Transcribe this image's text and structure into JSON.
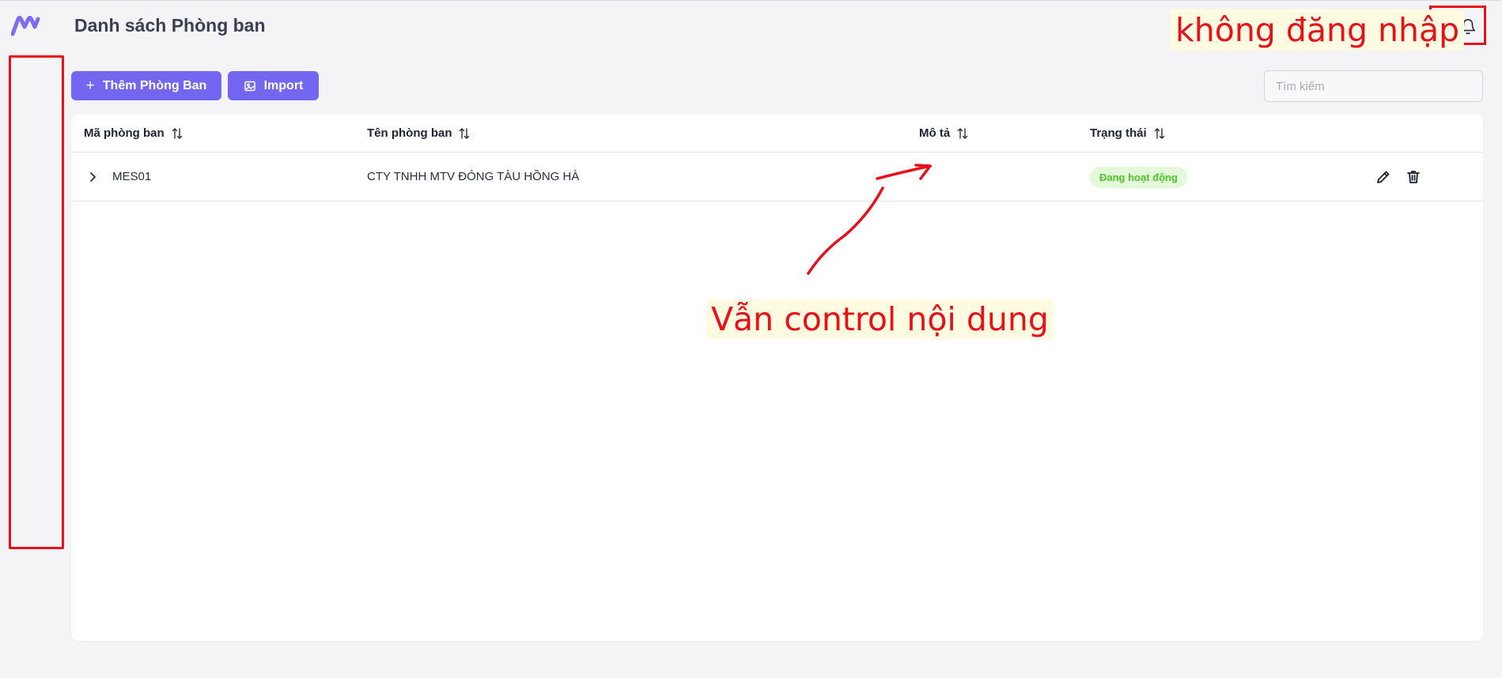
{
  "header": {
    "title": "Danh sách Phòng ban",
    "logo_icon": "logo-m-icon",
    "notification_icon": "bell-icon"
  },
  "toolbar": {
    "add_label": "Thêm Phòng Ban",
    "import_label": "Import",
    "search_placeholder": "Tìm kiếm"
  },
  "table": {
    "columns": [
      {
        "label": "Mã phòng ban"
      },
      {
        "label": "Tên phòng ban"
      },
      {
        "label": "Mô tả"
      },
      {
        "label": "Trạng thái"
      }
    ],
    "rows": [
      {
        "code": "MES01",
        "name": "CTY TNHH MTV ĐÓNG TÀU HỒNG HÀ",
        "description": "",
        "status": "Đang hoạt động"
      }
    ]
  },
  "annotations": {
    "login_note": "không đăng nhập",
    "content_note": "Vẫn control nội dung"
  },
  "colors": {
    "accent": "#7366f0",
    "annotation_red": "#e8101a",
    "status_active_bg": "#e3f9d9",
    "status_active_text": "#4ec32a"
  }
}
